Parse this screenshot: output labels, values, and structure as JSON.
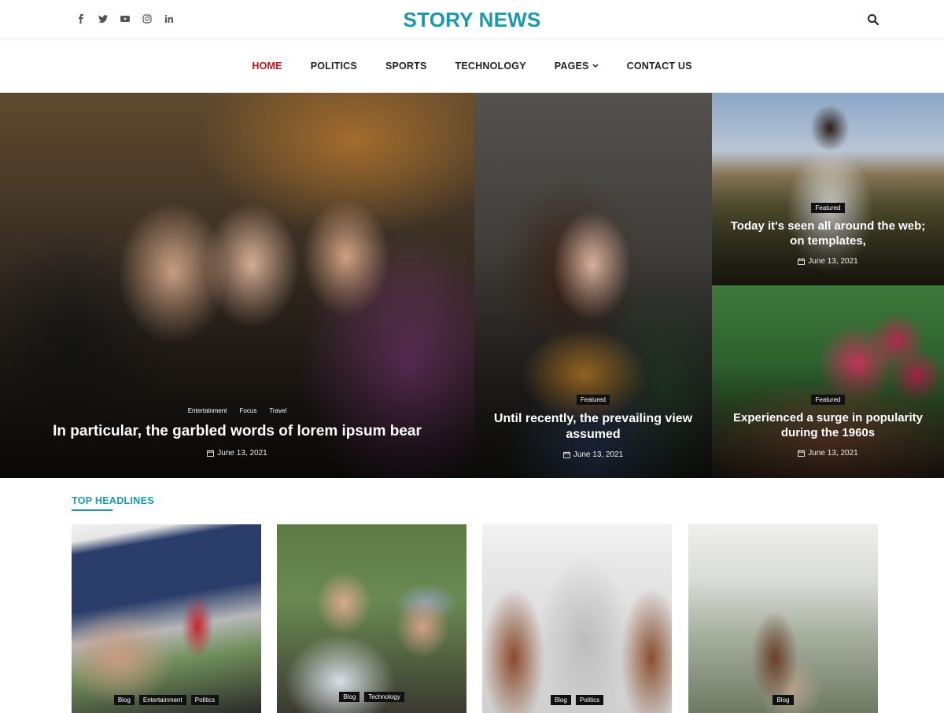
{
  "header": {
    "brand": "STORY NEWS",
    "social_icons": [
      "facebook-icon",
      "twitter-icon",
      "youtube-icon",
      "instagram-icon",
      "linkedin-icon"
    ]
  },
  "nav": {
    "items": [
      "HOME",
      "POLITICS",
      "SPORTS",
      "TECHNOLOGY",
      "PAGES",
      "CONTACT US"
    ],
    "active": "HOME"
  },
  "hero": {
    "main": {
      "tags": [
        "Entertainment",
        "Focus",
        "Travel"
      ],
      "title": "In particular, the garbled words of lorem ipsum bear",
      "date": "June 13, 2021"
    },
    "middle": {
      "tags": [
        "Featured"
      ],
      "title": "Until recently, the prevailing view assumed",
      "date": "June 13, 2021"
    },
    "right_top": {
      "tags": [
        "Featured"
      ],
      "title": "Today it's seen all around the web; on templates,",
      "date": "June 13, 2021"
    },
    "right_bottom": {
      "tags": [
        "Featured"
      ],
      "title": "Experienced a surge in popularity during the 1960s",
      "date": "June 13, 2021"
    }
  },
  "top_headlines": {
    "heading": "TOP HEADLINES",
    "cards": [
      {
        "tags": [
          "Blog",
          "Entertainment",
          "Politics"
        ]
      },
      {
        "tags": [
          "Blog",
          "Technology"
        ]
      },
      {
        "tags": [
          "Blog",
          "Politics"
        ]
      },
      {
        "tags": [
          "Blog"
        ]
      }
    ]
  },
  "colors": {
    "accent": "#1a9aa8",
    "active_nav": "#c1121f"
  }
}
